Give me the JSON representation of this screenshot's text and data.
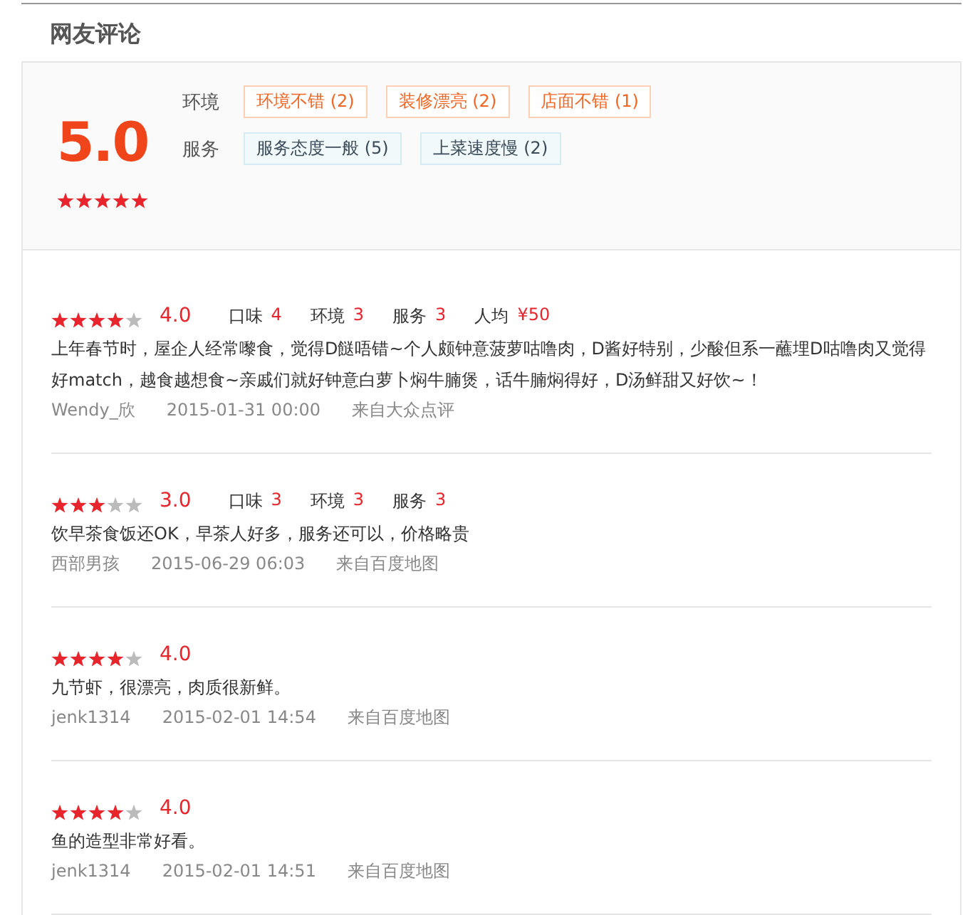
{
  "title": "网友评论",
  "summary": {
    "score": "5.0",
    "stars": 5,
    "tag_groups": [
      {
        "label": "环境",
        "tags": [
          {
            "text": "环境不错 (2)",
            "kind": "positive"
          },
          {
            "text": "装修漂亮 (2)",
            "kind": "positive"
          },
          {
            "text": "店面不错 (1)",
            "kind": "positive"
          }
        ]
      },
      {
        "label": "服务",
        "tags": [
          {
            "text": "服务态度一般 (5)",
            "kind": "neutral"
          },
          {
            "text": "上菜速度慢 (2)",
            "kind": "neutral"
          }
        ]
      }
    ]
  },
  "reviews": [
    {
      "stars": 4,
      "score": "4.0",
      "subscores": [
        {
          "label": "口味",
          "value": "4"
        },
        {
          "label": "环境",
          "value": "3"
        },
        {
          "label": "服务",
          "value": "3"
        },
        {
          "label": "人均",
          "value": "¥50"
        }
      ],
      "text": "上年春节时，屋企人经常嚟食，觉得D餸唔错~个人颇钟意菠萝咕噜肉，D酱好特别，少酸但系一蘸埋D咕噜肉又觉得好match，越食越想食~亲戚们就好钟意白萝卜焖牛腩煲，话牛腩焖得好，D汤鲜甜又好饮~！",
      "user": "Wendy_欣",
      "time": "2015-01-31 00:00",
      "source": "来自大众点评"
    },
    {
      "stars": 3,
      "score": "3.0",
      "subscores": [
        {
          "label": "口味",
          "value": "3"
        },
        {
          "label": "环境",
          "value": "3"
        },
        {
          "label": "服务",
          "value": "3"
        }
      ],
      "text": "饮早茶食饭还OK，早茶人好多，服务还可以，价格略贵",
      "user": "西部男孩",
      "time": "2015-06-29 06:03",
      "source": "来自百度地图"
    },
    {
      "stars": 4,
      "score": "4.0",
      "text": "九节虾，很漂亮，肉质很新鲜。",
      "user": "jenk1314",
      "time": "2015-02-01 14:54",
      "source": "来自百度地图"
    },
    {
      "stars": 4,
      "score": "4.0",
      "text": "鱼的造型非常好看。",
      "user": "jenk1314",
      "time": "2015-02-01 14:51",
      "source": "来自百度地图"
    }
  ]
}
